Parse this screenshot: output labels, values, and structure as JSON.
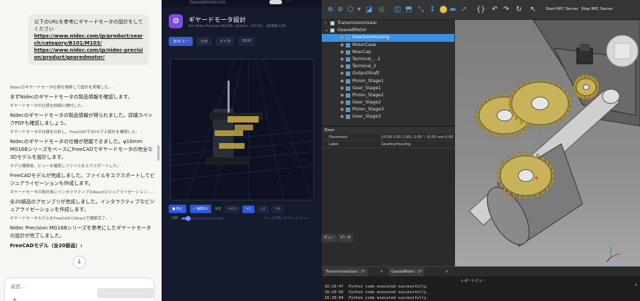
{
  "chat": {
    "user_message": "以下のURLを参考にギヤードモータの設計をしてください",
    "links": [
      "https://www.nidec.com/jp/product/search/category/B101/M103/",
      "https://www.nidec.com/jp/nidec-precision/product/gearedmotor/"
    ],
    "log": [
      {
        "kind": "step",
        "text": "Nidecのギヤードモータ仕様を検索して設計を準備した。"
      },
      {
        "kind": "msg",
        "text": "まずNidecのギヤードモータの製品情報を確認します。"
      },
      {
        "kind": "step",
        "text": "ギヤードモータの仕様を詳細に検討した。"
      },
      {
        "kind": "msg",
        "text": "Nidecのギヤードモータの製品情報が得られました。詳細スペックPDFも確認しましょう。"
      },
      {
        "kind": "step",
        "text": "ギヤードモータの仕様を分析し、FreeCADで3Dモデル設計を構想した。"
      },
      {
        "kind": "msg",
        "text": "Nidecのギヤードモータの仕様が把握できました。φ16mm MG16BシリーズをベースにFreeCADでギヤードモータの完全な3Dモデルを設計します。"
      },
      {
        "kind": "step",
        "text": "モデル構築後、ビューを確認しファイルをエクスポートした。"
      },
      {
        "kind": "msg",
        "text": "FreeCADモデルが完成しました。ファイルをエクスポートしてビジュアライゼーションも作成します。"
      },
      {
        "kind": "step",
        "text": "ギヤードモータの設計用にインタラクティブなReactビジュアライゼーション..."
      },
      {
        "kind": "msg",
        "text": "全20部品のアセンブリが完成しました。インタラクティブなビジュアライゼーションを作成します。"
      },
      {
        "kind": "step",
        "text": "ギヤードモータモデルをFreeCADとReactで構築完了。"
      },
      {
        "kind": "msg",
        "text": "Nidec Precision MG16Bシリーズを参考にしたギヤードモータの設計が完了しました。"
      },
      {
        "kind": "msg-bold",
        "text": "FreeCADモデル（全20部品）:"
      }
    ],
    "scroll_down_glyph": "↓",
    "reply_placeholder": "返信...",
    "reply_plus": "+"
  },
  "app": {
    "tab_text": "Gearedmotor-Viz",
    "dots": "⋯",
    "logo_glyph": "⚙",
    "title": "ギヤードモータ設計",
    "subtitle": "Ref: Nidec Precision MG16B · φ16mm · 12V DC · 3段減速 1/36",
    "tabs": [
      {
        "label": "3Dビュー",
        "active": true
      },
      {
        "label": "仕様",
        "active": false
      },
      {
        "label": "ギヤ列",
        "active": false
      },
      {
        "label": "BOM",
        "active": false
      }
    ],
    "controls": {
      "stop": "■ 停止",
      "explode": "⤢ 展開(E)",
      "speed_label": "速度",
      "speeds": [
        {
          "label": "×0.5",
          "active": false
        },
        {
          "label": "×1",
          "active": true
        },
        {
          "label": "×2",
          "active": false
        },
        {
          "label": "×4",
          "active": false
        }
      ],
      "slider_label": "分解",
      "slider_value": 0.15,
      "hint": "ドラッグ:回転 / スクロール:ズーム"
    }
  },
  "freecad": {
    "toolbar": {
      "start_server": "Start RPC Server",
      "stop_server": "Stop RPC Server"
    },
    "tree": [
      {
        "label": "TransmissionGear",
        "level": 0,
        "expander": "›",
        "selected": false
      },
      {
        "label": "GearedMotor",
        "level": 0,
        "expander": "⌄",
        "selected": false
      },
      {
        "label": "GearboxHousing",
        "level": 1,
        "selected": true
      },
      {
        "label": "MotorCase",
        "level": 1,
        "selected": false
      },
      {
        "label": "RearCap",
        "level": 1,
        "selected": false
      },
      {
        "label": "Terminal_...2",
        "level": 1,
        "selected": false
      },
      {
        "label": "Terminal_2",
        "level": 1,
        "selected": false
      },
      {
        "label": "OutputShaft",
        "level": 1,
        "selected": false
      },
      {
        "label": "Pinion_Stage1",
        "level": 1,
        "selected": false
      },
      {
        "label": "Gear_Stage1",
        "level": 1,
        "selected": false
      },
      {
        "label": "Pinion_Stage2",
        "level": 1,
        "selected": false
      },
      {
        "label": "Gear_Stage2",
        "level": 1,
        "selected": false
      },
      {
        "label": "Pinion_Stage3",
        "level": 1,
        "selected": false
      },
      {
        "label": "Gear_Stage3",
        "level": 1,
        "selected": false
      }
    ],
    "props_group": "Base",
    "props": [
      {
        "key": "Placement",
        "value": "[(0.00 0.00 1.00); 0.00 °; (0.00 mm 0.00 ..."
      },
      {
        "key": "Label",
        "value": "GearboxHousing"
      }
    ],
    "combo_tabs": [
      "ビュー",
      "データ"
    ],
    "doc_tabs": [
      "TransmissionGear : 1*",
      "GearedMotor : 1*"
    ],
    "doc_close": "×",
    "report_title": "レポートビュー",
    "report_lines": [
      {
        "time": "16:29:47",
        "text": "Python code executed successfully."
      },
      {
        "time": "16:29:50",
        "text": "Python code executed successfully."
      },
      {
        "time": "16:30:04",
        "text": "Python code executed successfully."
      }
    ],
    "accent": "#3d8fe0",
    "gear_color": "#c8b25a"
  }
}
